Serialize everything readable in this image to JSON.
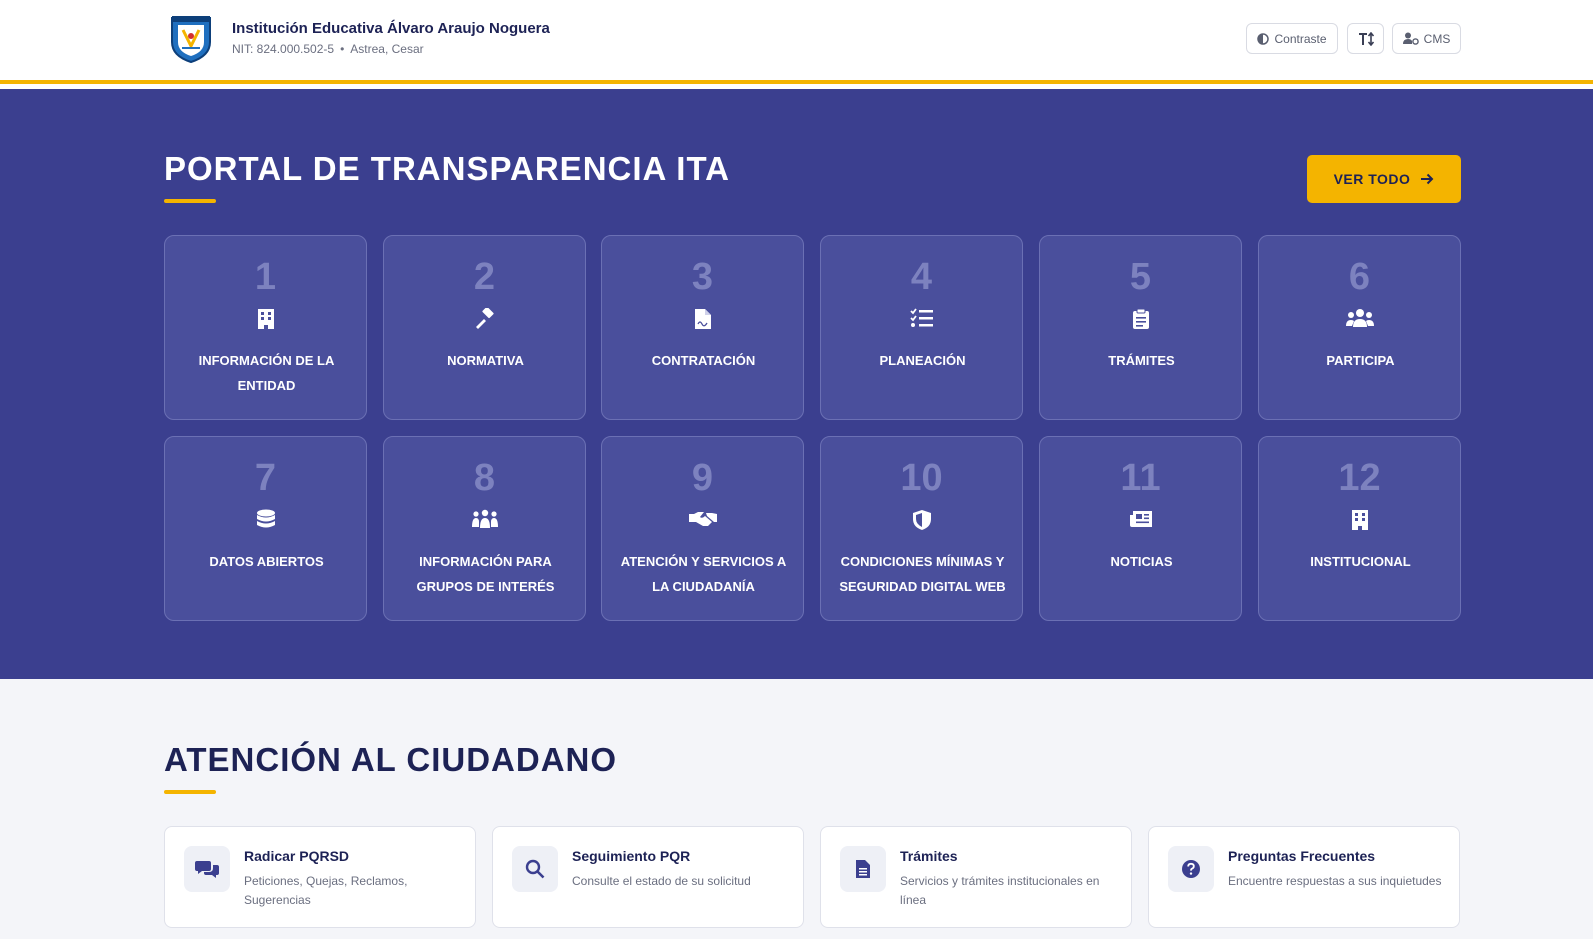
{
  "header": {
    "institution": "Institución Educativa Álvaro Araujo Noguera",
    "nit": "NIT: 824.000.502-5",
    "location": "Astrea, Cesar",
    "contrast_label": "Contraste",
    "cms_label": "CMS"
  },
  "transparency": {
    "title": "PORTAL DE TRANSPARENCIA ITA",
    "view_all": "VER TODO",
    "cards": [
      {
        "num": "1",
        "label": "INFORMACIÓN DE LA ENTIDAD",
        "icon": "building-icon"
      },
      {
        "num": "2",
        "label": "NORMATIVA",
        "icon": "gavel-icon"
      },
      {
        "num": "3",
        "label": "CONTRATACIÓN",
        "icon": "contract-icon"
      },
      {
        "num": "4",
        "label": "PLANEACIÓN",
        "icon": "tasks-icon"
      },
      {
        "num": "5",
        "label": "TRÁMITES",
        "icon": "clipboard-icon"
      },
      {
        "num": "6",
        "label": "PARTICIPA",
        "icon": "users-icon"
      },
      {
        "num": "7",
        "label": "DATOS ABIERTOS",
        "icon": "database-icon"
      },
      {
        "num": "8",
        "label": "INFORMACIÓN PARA GRUPOS DE INTERÉS",
        "icon": "people-group-icon"
      },
      {
        "num": "9",
        "label": "ATENCIÓN Y SERVICIOS A LA CIUDADANÍA",
        "icon": "handshake-icon"
      },
      {
        "num": "10",
        "label": "CONDICIONES MÍNIMAS Y SEGURIDAD DIGITAL WEB",
        "icon": "shield-icon"
      },
      {
        "num": "11",
        "label": "NOTICIAS",
        "icon": "newspaper-icon"
      },
      {
        "num": "12",
        "label": "INSTITUCIONAL",
        "icon": "building-icon"
      }
    ]
  },
  "citizen": {
    "title": "ATENCIÓN AL CIUDADANO",
    "cards": [
      {
        "title": "Radicar PQRSD",
        "desc": "Peticiones, Quejas, Reclamos, Sugerencias",
        "icon": "comments-icon"
      },
      {
        "title": "Seguimiento PQR",
        "desc": "Consulte el estado de su solicitud",
        "icon": "search-icon"
      },
      {
        "title": "Trámites",
        "desc": "Servicios y trámites institucionales en línea",
        "icon": "document-icon"
      },
      {
        "title": "Preguntas Frecuentes",
        "desc": "Encuentre respuestas a sus inquietudes",
        "icon": "question-icon"
      }
    ]
  },
  "colors": {
    "primary": "#3b3f8f",
    "accent": "#f4b400",
    "dark": "#1d2255"
  }
}
